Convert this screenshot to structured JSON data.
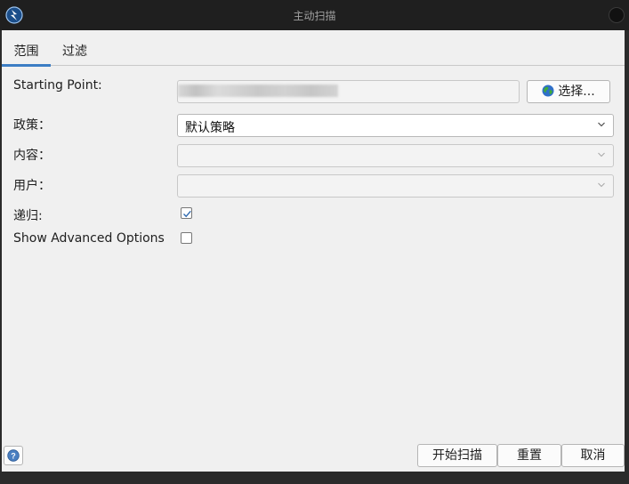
{
  "window": {
    "title": "主动扫描"
  },
  "tabs": [
    {
      "label": "范围",
      "active": true
    },
    {
      "label": "过滤",
      "active": false
    }
  ],
  "form": {
    "starting_point": {
      "label": "Starting Point:",
      "value": "",
      "select_button_label": "选择..."
    },
    "policy": {
      "label": "政策：",
      "value": "默认策略"
    },
    "context": {
      "label": "内容：",
      "value": ""
    },
    "user": {
      "label": "用户：",
      "value": ""
    },
    "recurse": {
      "label": "递归:",
      "checked": true
    },
    "advanced": {
      "label": "Show Advanced Options",
      "checked": false
    }
  },
  "footer": {
    "start_scan_label": "开始扫描",
    "reset_label": "重置",
    "cancel_label": "取消"
  },
  "icons": {
    "app": "zap-logo-icon",
    "globe": "globe-icon",
    "help": "help-icon",
    "chevron": "chevron-down-icon"
  },
  "colors": {
    "accent": "#3c7dc4",
    "panel": "#f0f0f0",
    "titlebar": "#1f1f1f"
  }
}
